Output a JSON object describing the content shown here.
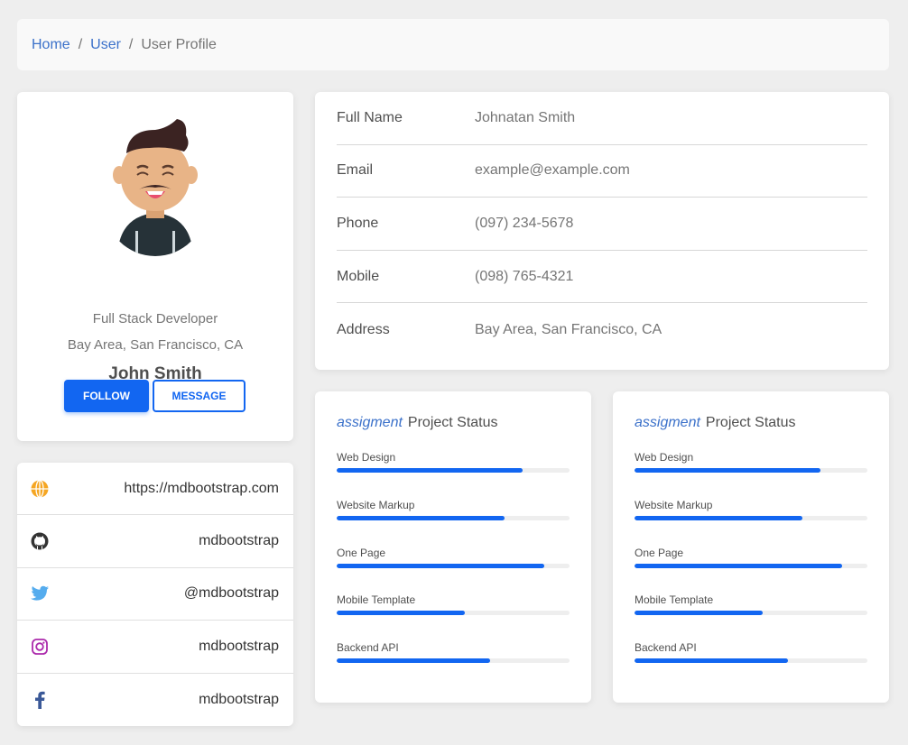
{
  "breadcrumb": {
    "items": [
      {
        "label": "Home",
        "link": true
      },
      {
        "label": "User",
        "link": true
      },
      {
        "label": "User Profile",
        "link": false
      }
    ],
    "separator": "/"
  },
  "profile": {
    "name": "John Smith",
    "role": "Full Stack Developer",
    "location": "Bay Area, San Francisco, CA",
    "follow_label": "FOLLOW",
    "message_label": "MESSAGE"
  },
  "links": [
    {
      "icon": "globe-icon",
      "text": "https://mdbootstrap.com",
      "color": "#f5a623"
    },
    {
      "icon": "github-icon",
      "text": "mdbootstrap",
      "color": "#333333"
    },
    {
      "icon": "twitter-icon",
      "text": "@mdbootstrap",
      "color": "#55acee"
    },
    {
      "icon": "instagram-icon",
      "text": "mdbootstrap",
      "color": "#ac2bac"
    },
    {
      "icon": "facebook-icon",
      "text": "mdbootstrap",
      "color": "#3b5998"
    }
  ],
  "info": [
    {
      "label": "Full Name",
      "value": "Johnatan Smith"
    },
    {
      "label": "Email",
      "value": "example@example.com"
    },
    {
      "label": "Phone",
      "value": "(097) 234-5678"
    },
    {
      "label": "Mobile",
      "value": "(098) 765-4321"
    },
    {
      "label": "Address",
      "value": "Bay Area, San Francisco, CA"
    }
  ],
  "projects": [
    {
      "title_em": "assigment",
      "title": "Project Status",
      "items": [
        {
          "label": "Web Design",
          "percent": 80
        },
        {
          "label": "Website Markup",
          "percent": 72
        },
        {
          "label": "One Page",
          "percent": 89
        },
        {
          "label": "Mobile Template",
          "percent": 55
        },
        {
          "label": "Backend API",
          "percent": 66
        }
      ]
    },
    {
      "title_em": "assigment",
      "title": "Project Status",
      "items": [
        {
          "label": "Web Design",
          "percent": 80
        },
        {
          "label": "Website Markup",
          "percent": 72
        },
        {
          "label": "One Page",
          "percent": 89
        },
        {
          "label": "Mobile Template",
          "percent": 55
        },
        {
          "label": "Backend API",
          "percent": 66
        }
      ]
    }
  ],
  "colors": {
    "primary": "#1266f1",
    "link": "#3b71ca"
  }
}
